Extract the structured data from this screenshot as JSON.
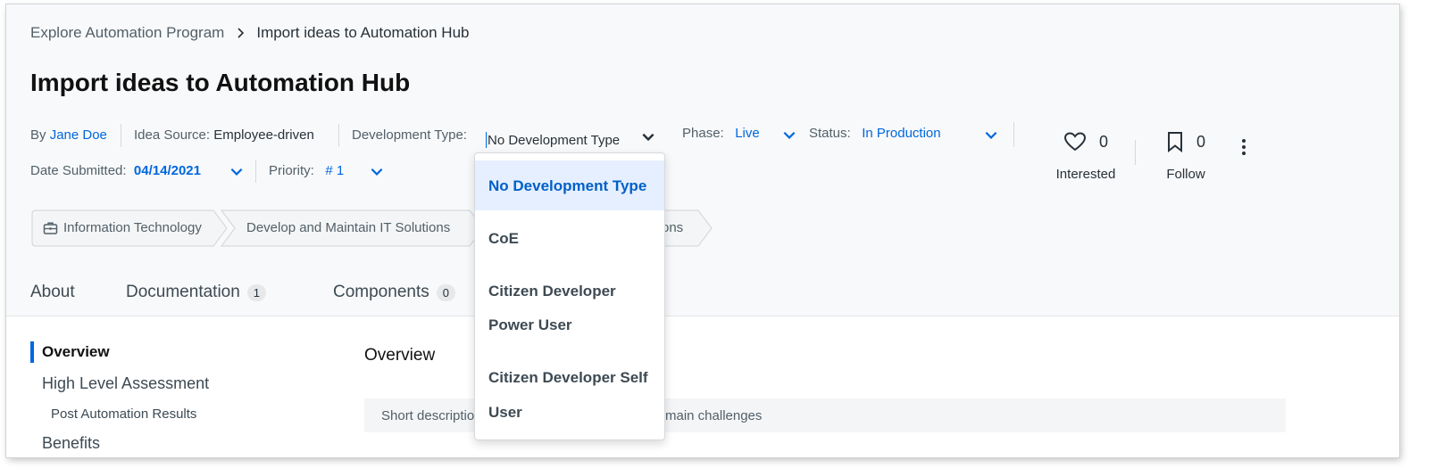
{
  "breadcrumb": {
    "parent": "Explore Automation Program",
    "current": "Import ideas to Automation Hub"
  },
  "page_title": "Import ideas to Automation Hub",
  "meta": {
    "by_label": "By",
    "by_value": "Jane Doe",
    "idea_source_label": "Idea Source:",
    "idea_source_value": "Employee-driven",
    "development_type_label": "Development Type:",
    "development_type_value": "No Development Type",
    "phase_label": "Phase:",
    "phase_value": "Live",
    "status_label": "Status:",
    "status_value": "In Production",
    "date_submitted_label": "Date Submitted:",
    "date_submitted_value": "04/14/2021",
    "priority_label": "Priority:",
    "priority_value": "# 1"
  },
  "actions": {
    "interested_count": "0",
    "interested_label": "Interested",
    "follow_count": "0",
    "follow_label": "Follow"
  },
  "categories": [
    "Information Technology",
    "Develop and Maintain IT Solutions",
    "ons"
  ],
  "tabs": [
    {
      "label": "About"
    },
    {
      "label": "Documentation",
      "count": "1"
    },
    {
      "label": "Components",
      "count": "0"
    }
  ],
  "sidebar": {
    "items": [
      "Overview",
      "High Level Assessment",
      "Post Automation Results",
      "Benefits"
    ]
  },
  "content": {
    "section_title": "Overview",
    "description_left": "Short descriptio",
    "description_right": "main challenges"
  },
  "dropdown": {
    "options": [
      "No Development Type",
      "CoE",
      "Citizen Developer",
      "Power User",
      "Citizen Developer Self",
      "User"
    ],
    "selected": "No Development Type"
  },
  "colors": {
    "link": "#0067df",
    "selected_bg": "#e5efff",
    "header_bg": "#f8f9fa"
  }
}
